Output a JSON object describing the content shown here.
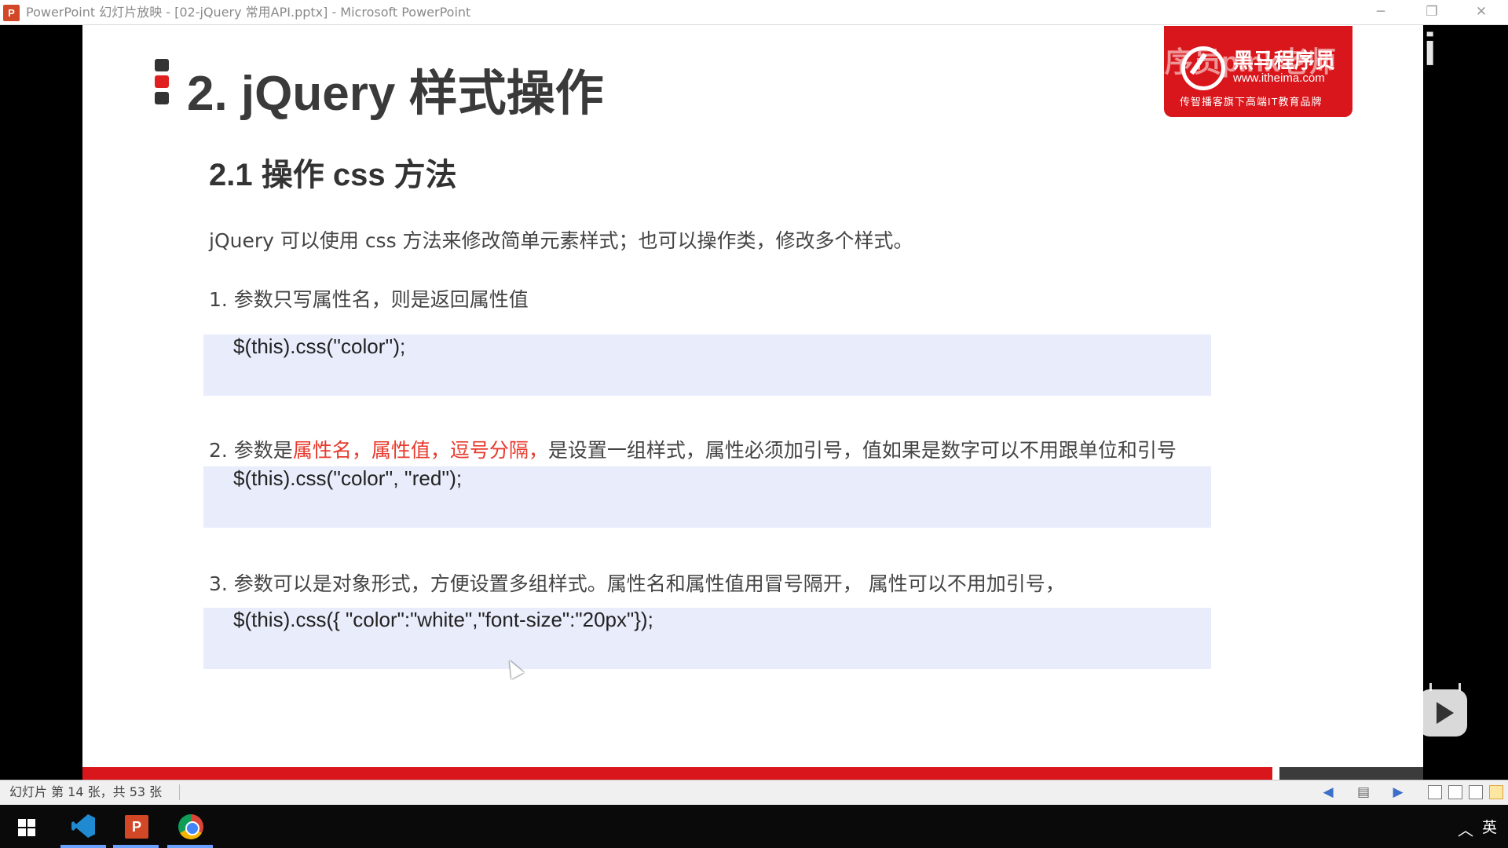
{
  "window": {
    "app_icon_letter": "P",
    "title": "PowerPoint 幻灯片放映 - [02-jQuery 常用API.pptx] - Microsoft PowerPoint",
    "minimize": "─",
    "restore": "❐",
    "close": "✕"
  },
  "slide": {
    "title": "2. jQuery 样式操作",
    "logo": {
      "name": "黑马程序员",
      "url": "www.itheima.com",
      "slogan": "传智播客旗下高端IT教育品牌"
    },
    "section_heading": "2.1  操作 css 方法",
    "intro": "jQuery 可以使用 css 方法来修改简单元素样式；也可以操作类，修改多个样式。",
    "items": [
      {
        "text": "1. 参数只写属性名，则是返回属性值",
        "code": "$(this).css(''color'');"
      },
      {
        "prefix": "2.  参数是",
        "highlight": "属性名，属性值，逗号分隔，",
        "suffix": "是设置一组样式，属性必须加引号，值如果是数字可以不用跟单位和引号",
        "code": "$(this).css(''color'', ''red'');"
      },
      {
        "text": "3.  参数可以是对象形式，方便设置多组样式。属性名和属性值用冒号隔开， 属性可以不用加引号，",
        "code": "$(this).css({ \"color\":\"white\",\"font-size\":\"20px\"});"
      }
    ],
    "accent_color": "#d9161b",
    "highlight_color": "#e8392c",
    "code_bg_color": "#e8ecfb"
  },
  "watermark": {
    "text": "黑马程序员pink老师",
    "bili": "bili"
  },
  "statusbar": {
    "slide_info": "幻灯片 第 14 张，共 53 张"
  },
  "taskbar": {
    "ppt_letter": "P",
    "ime": "英",
    "tray_arrow": "︿"
  }
}
